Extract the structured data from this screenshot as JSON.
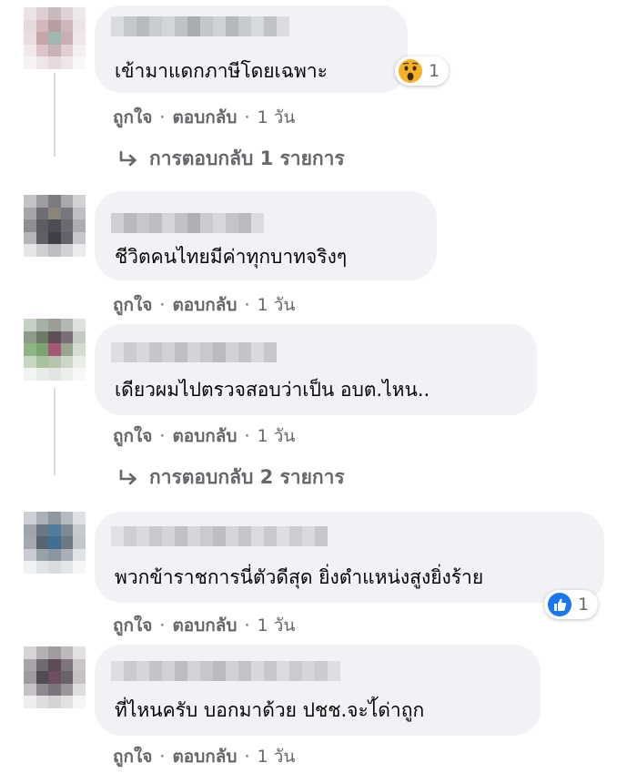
{
  "comments": [
    {
      "text": "เข้ามาแดกภาษีโดยเฉพาะ",
      "reaction": {
        "icon": "wow-emoji-icon",
        "count": "1"
      },
      "replies": "การตอบกลับ 1 รายการ"
    },
    {
      "text": "ชีวิตคนไทยมีค่าทุกบาทจริงๆ"
    },
    {
      "text": "เดียวผมไปตรวจสอบว่าเป็น อบต.ไหน..",
      "replies": "การตอบกลับ 2 รายการ"
    },
    {
      "text": "พวกข้าราชการนี่ตัวดีสุด ยิ่งตำแหน่งสูงยิ่งร้าย",
      "reaction": {
        "icon": "like-icon",
        "count": "1"
      }
    },
    {
      "text": "ที่ไหนครับ บอกมาด้วย ปชช.จะไ้ด่าถูก"
    }
  ],
  "actions": {
    "like": "ถูกใจ",
    "reply": "ตอบกลับ",
    "separator": "·",
    "time": "1 วัน"
  },
  "colors": {
    "bubble": "#f0f2f5",
    "meta": "#65676b",
    "text": "#050505",
    "like": "#1877f2"
  }
}
